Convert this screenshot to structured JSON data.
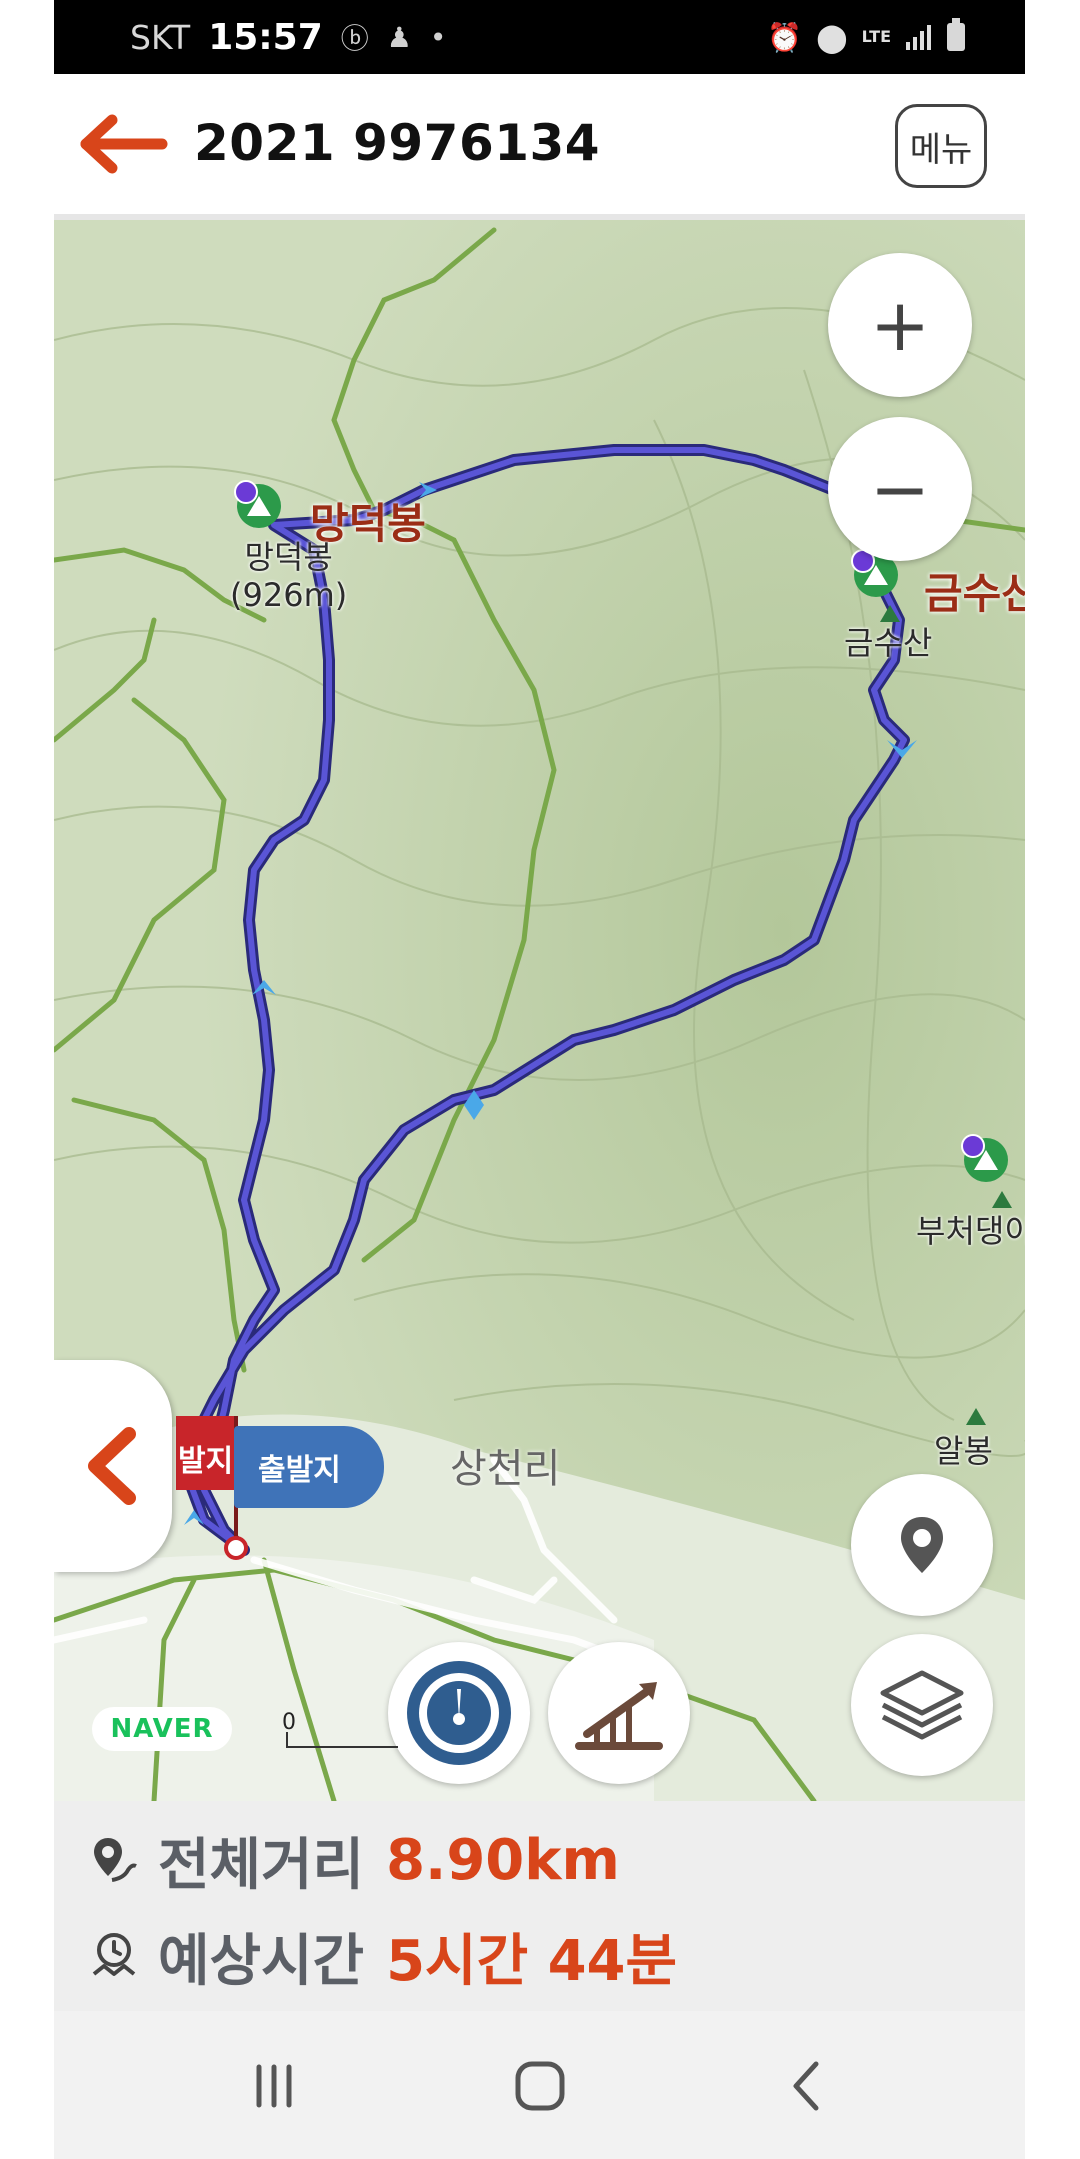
{
  "status_bar": {
    "carrier": "SKT",
    "time": "15:57",
    "network": "LTE",
    "icons": [
      "b-icon",
      "notification-icon",
      "dot-icon",
      "alarm-icon",
      "location-icon",
      "signal-icon",
      "battery-icon"
    ]
  },
  "header": {
    "title": "2021 9976134",
    "menu_label": "메뉴"
  },
  "map": {
    "peaks": [
      {
        "name": "망덕봉",
        "label": "망덕봉",
        "elevation": "(926m)"
      },
      {
        "name": "금수산",
        "label": "금수산"
      },
      {
        "name": "부처댕이",
        "label": "부처댕이"
      },
      {
        "name": "알봉",
        "label": "알봉"
      }
    ],
    "village": "상천리",
    "flags": {
      "start": "출발지",
      "end": "발지"
    },
    "zoom_in": "+",
    "zoom_out": "−",
    "attribution": "NAVER",
    "scale_zero": "0",
    "colors": {
      "route": "#4a45c8",
      "trail": "#7aa84a",
      "accent": "#d8451a"
    }
  },
  "summary": {
    "distance_label": "전체거리",
    "distance_value": "8.90km",
    "time_label": "예상시간",
    "time_value": "5시간 44분"
  },
  "nav": {
    "recents": "recents-icon",
    "home": "home-icon",
    "back": "back-icon"
  }
}
